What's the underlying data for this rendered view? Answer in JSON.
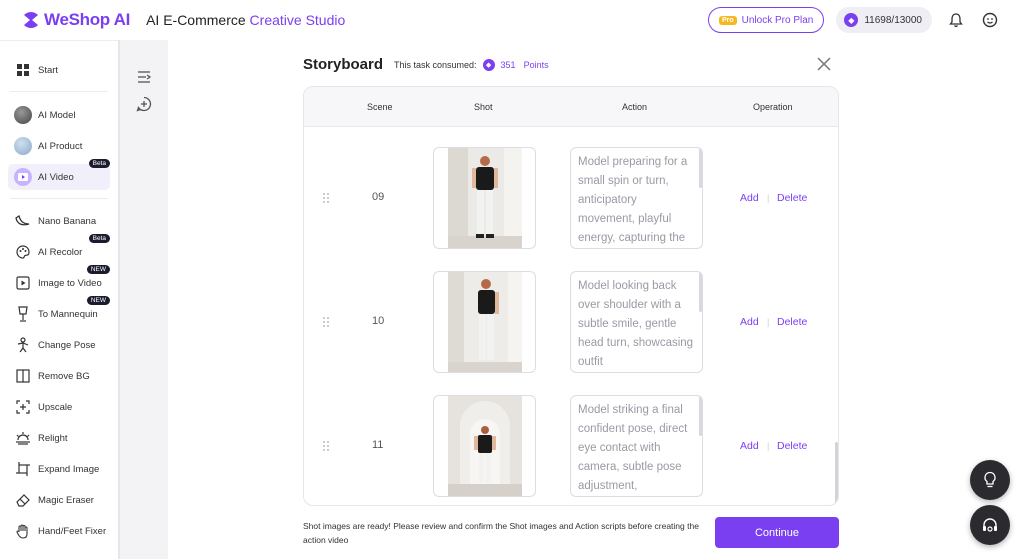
{
  "header": {
    "logo_text": "WeShop AI",
    "app_title_prefix": "AI E-Commerce ",
    "app_title_accent": "Creative Studio",
    "pro_tag": "Pro",
    "pro_label": "Unlock Pro Plan",
    "credits": "11698/13000"
  },
  "sidebar": {
    "items": [
      {
        "label": "Start",
        "icon": "grid-icon"
      },
      {
        "label": "AI Model",
        "icon": "model-avatar"
      },
      {
        "label": "AI Product",
        "icon": "product-avatar"
      },
      {
        "label": "AI Video",
        "icon": "video-icon",
        "badge": "Beta"
      },
      {
        "label": "Nano Banana",
        "icon": "banana-icon"
      },
      {
        "label": "AI Recolor",
        "icon": "palette-icon",
        "badge": "Beta"
      },
      {
        "label": "Image to Video",
        "icon": "image-video-icon",
        "badge": "NEW"
      },
      {
        "label": "To Mannequin",
        "icon": "mannequin-icon",
        "badge": "NEW"
      },
      {
        "label": "Change Pose",
        "icon": "pose-icon"
      },
      {
        "label": "Remove BG",
        "icon": "remove-bg-icon"
      },
      {
        "label": "Upscale",
        "icon": "upscale-icon"
      },
      {
        "label": "Relight",
        "icon": "relight-icon"
      },
      {
        "label": "Expand Image",
        "icon": "expand-icon"
      },
      {
        "label": "Magic Eraser",
        "icon": "eraser-icon"
      },
      {
        "label": "Hand/Feet Fixer",
        "icon": "hand-icon"
      }
    ]
  },
  "storyboard": {
    "title": "Storyboard",
    "consumed_label": "This task consumed:",
    "points_value": "351",
    "points_label": "Points",
    "columns": [
      "Scene",
      "Shot",
      "Action",
      "Operation"
    ],
    "rows": [
      {
        "scene": "09",
        "action": "Model preparing for a small spin or turn, anticipatory movement, playful energy, capturing the",
        "add": "Add",
        "delete": "Delete"
      },
      {
        "scene": "10",
        "action": "Model looking back over shoulder with a subtle smile, gentle head turn, showcasing outfit",
        "add": "Add",
        "delete": "Delete"
      },
      {
        "scene": "11",
        "action": "Model striking a final confident pose, direct eye contact with camera, subtle pose adjustment,",
        "add": "Add",
        "delete": "Delete"
      }
    ],
    "separator": "|",
    "footer_message": "Shot images are ready! Please review and confirm the Shot images and Action scripts before creating the action video",
    "continue_label": "Continue"
  },
  "colors": {
    "accent": "#7b3ff2",
    "dark": "#2b2b2f"
  }
}
